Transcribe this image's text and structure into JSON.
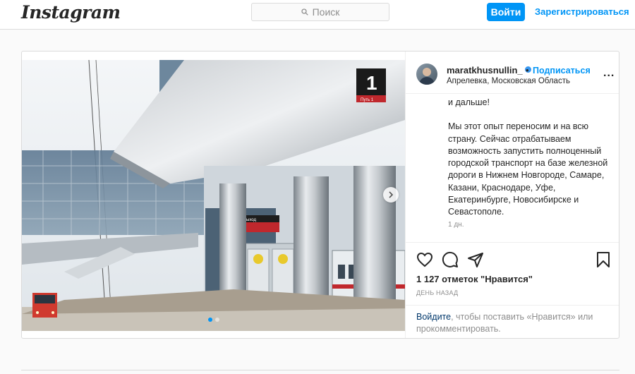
{
  "header": {
    "logo": "Instagram",
    "search_placeholder": "Поиск",
    "login_label": "Войти",
    "signup_label": "Зарегистрироваться"
  },
  "post": {
    "username": "maratkhusnullin_",
    "separator": "•",
    "follow_label": "Подписаться",
    "location": "Апрелевка, Московская Область",
    "more_label": "...",
    "caption_lines": [
      "и дальше!",
      "Мы этот опыт переносим и на всю страну. Сейчас отрабатываем возможность запустить полноценный городской транспорт на базе железной дороги в Нижнем Новгороде, Самаре, Казани, Краснодаре, Уфе, Екатеринбурге, Новосибирске и Севастополе."
    ],
    "time_ago": "1 дн.",
    "likes": "1 127 отметок \"Нравится\"",
    "date": "ДЕНЬ НАЗАД",
    "comment_prompt_link": "Войдите",
    "comment_prompt_rest": ", чтобы поставить «Нравится» или прокомментировать.",
    "platform_number": "1",
    "platform_sign": "Путь 1",
    "exit_sign": "Выход"
  },
  "carousel": {
    "slide_count": 2,
    "active_slide": 1
  },
  "colors": {
    "accent": "#0095f6",
    "border": "#dbdbdb",
    "muted": "#8e8e8e",
    "background": "#fafafa"
  },
  "icons": [
    "search-icon",
    "verified-icon",
    "next-slide-icon",
    "heart-icon",
    "comment-icon",
    "share-icon",
    "bookmark-icon"
  ]
}
